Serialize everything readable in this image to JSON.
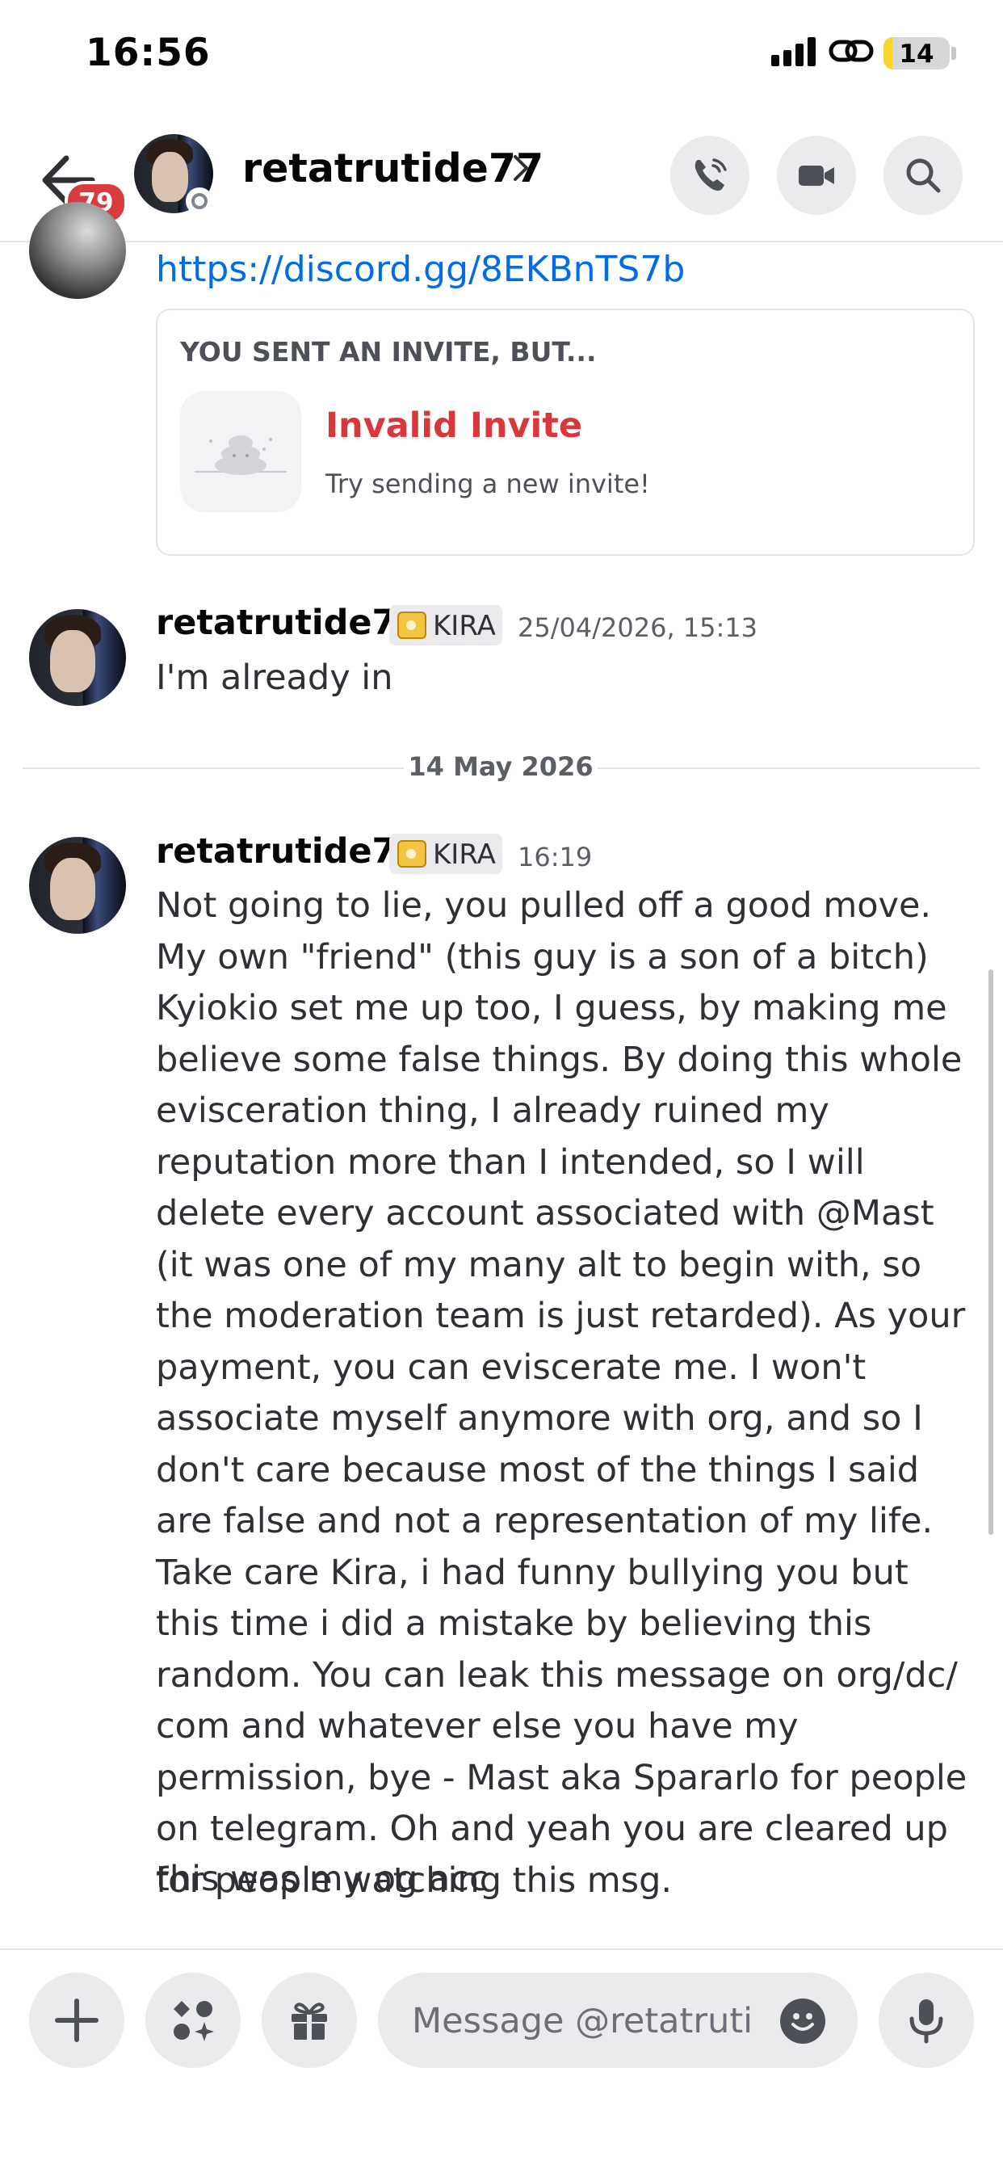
{
  "status_bar": {
    "time": "16:56",
    "battery": "14",
    "battery_fraction": 0.14
  },
  "header": {
    "unread_count": "79",
    "username": "retatrutide77"
  },
  "messages": {
    "invite": {
      "link": "https://discord.gg/8EKBnTS7b",
      "card_title": "YOU SENT AN INVITE, BUT...",
      "status": "Invalid Invite",
      "hint": "Try sending a new invite!"
    },
    "msg1": {
      "author": "retatrutide77",
      "role": "KIRA",
      "timestamp": "25/04/2026, 15:13",
      "text": "I'm already in"
    },
    "date_divider": "14 May 2026",
    "msg2": {
      "author": "retatrutide77",
      "role": "KIRA",
      "timestamp": "16:19",
      "text": "Not going to lie, you pulled off a good move. My own \"friend\" (this guy is a son of a bitch) Kyiokio set me up too, I guess, by making me believe some false things. By doing this whole evisceration thing, I already ruined my reputation more than I intended, so I will delete every account associated with @Mast (it was one of my many alt to begin with, so the moderation team is just retarded). As your payment, you can eviscerate me. I won't associate myself anymore with org, and so I don't care because most of the things I said are false and not a representation of my life. Take care Kira, i had funny bullying you but this time i did a mistake by believing this random. You can leak this message on org/dc/ com and whatever else you have my permission, bye - Mast aka Spararlo for people on telegram. Oh and yeah you are cleared up for people watching this msg.",
      "followup": "this was my og acc"
    }
  },
  "composer": {
    "placeholder": "Message @retatrutide77"
  },
  "colors": {
    "link": "#006ce7",
    "danger": "#da373c",
    "badge": "#d83c3e",
    "battery": "#f9d42b"
  },
  "icons": [
    "back-arrow-icon",
    "call-icon",
    "video-icon",
    "search-icon",
    "plus-icon",
    "apps-icon",
    "gift-icon",
    "emoji-icon",
    "microphone-icon",
    "crown-icon"
  ]
}
